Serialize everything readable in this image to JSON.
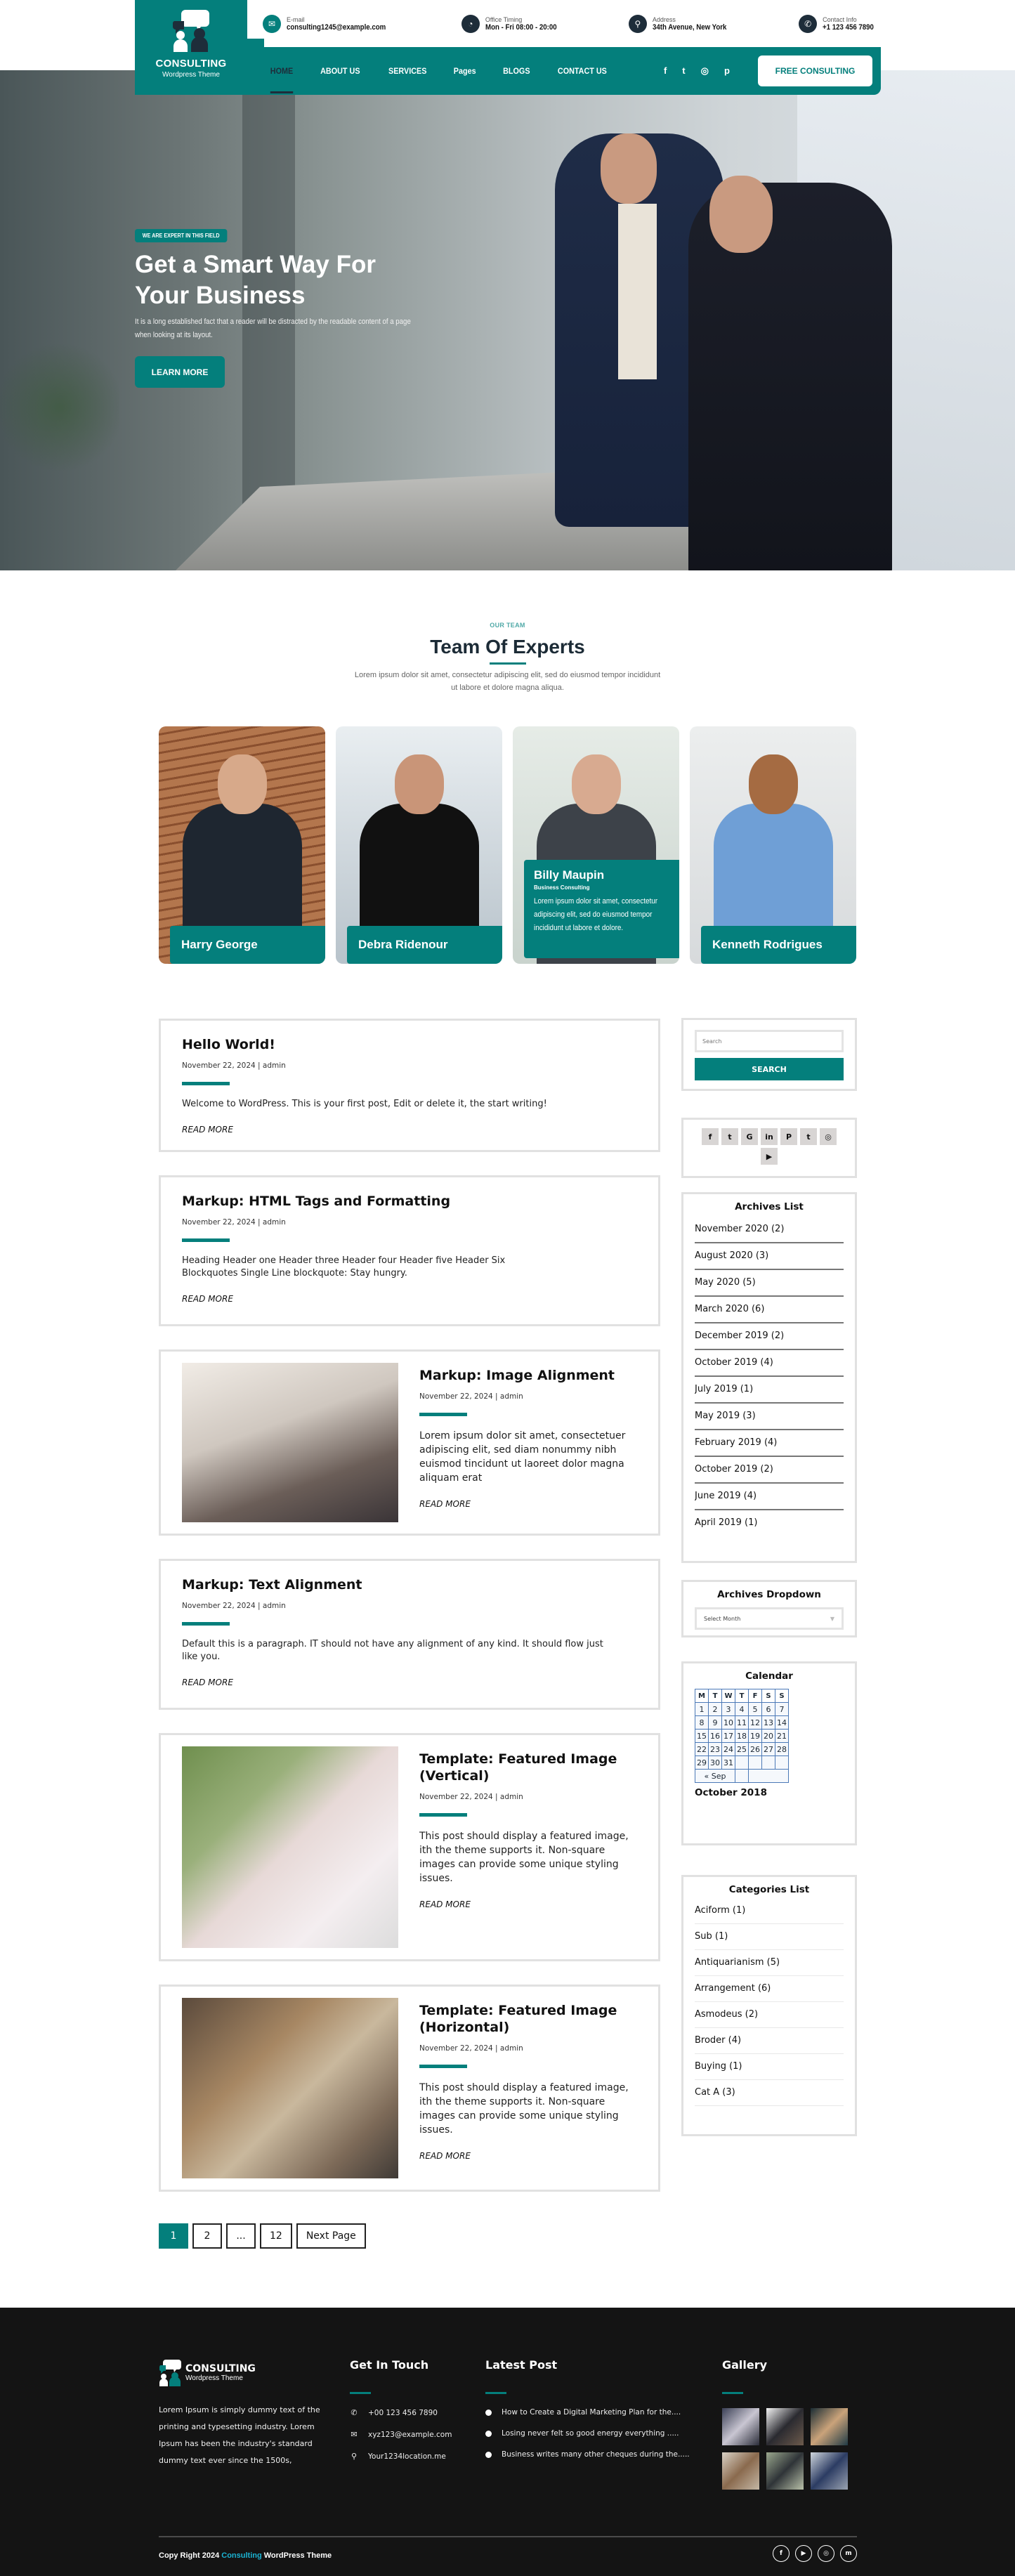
{
  "brand": {
    "title": "CONSULTING",
    "subtitle": "Wordpress Theme",
    "accent": "#047f7c",
    "dark": "#1e2d3a"
  },
  "topbar": {
    "items": [
      {
        "icon": "email-icon",
        "label": "E-mail",
        "value": "consulting1245@example.com"
      },
      {
        "icon": "clock-icon",
        "label": "Office Timing",
        "value": "Mon - Fri 08:00 - 20:00"
      },
      {
        "icon": "location-icon",
        "label": "Address",
        "value": "34th Avenue, New York"
      },
      {
        "icon": "phone-icon",
        "label": "Contact Info",
        "value": "+1 123 456 7890"
      }
    ]
  },
  "nav": {
    "links": [
      "HOME",
      "ABOUT US",
      "SERVICES",
      "Pages",
      "BLOGS",
      "CONTACT US"
    ],
    "active": "HOME",
    "social": [
      {
        "icon": "facebook-icon",
        "glyph": "f"
      },
      {
        "icon": "twitter-icon",
        "glyph": "🐦"
      },
      {
        "icon": "instagram-icon",
        "glyph": "◎"
      },
      {
        "icon": "pinterest-icon",
        "glyph": "𝓅"
      }
    ],
    "cta": "FREE CONSULTING"
  },
  "hero": {
    "badge": "WE ARE EXPERT IN THIS FIELD",
    "title": "Get a Smart Way For Your Business",
    "text": "It is a long established fact that a reader will be distracted by the readable content of a page when looking at its layout.",
    "button": "LEARN MORE"
  },
  "team": {
    "eyebrow": "OUR TEAM",
    "title": "Team Of Experts",
    "description": "Lorem ipsum dolor sit amet, consectetur adipiscing elit, sed do eiusmod tempor incididunt ut labore et dolore magna aliqua.",
    "members": [
      {
        "name": "Harry George"
      },
      {
        "name": "Debra Ridenour"
      },
      {
        "name": "Billy Maupin",
        "role": "Business Consulting",
        "bio": "Lorem ipsum dolor sit amet, consectetur adipiscing elit, sed do eiusmod tempor incididunt ut labore et dolore."
      },
      {
        "name": "Kenneth Rodrigues"
      }
    ]
  },
  "posts": [
    {
      "title": "Hello World!",
      "meta": "November 22, 2024 | admin",
      "excerpt": "Welcome to WordPress. This is your first post, Edit or delete it, the start writing!",
      "more": "READ MORE"
    },
    {
      "title": "Markup: HTML Tags and Formatting",
      "meta": "November 22, 2024 | admin",
      "excerpt": "Heading Header one Header three Header four Header five Header Six Blockquotes Single Line blockquote: Stay hungry.",
      "more": "READ MORE"
    },
    {
      "title": "Markup: Image Alignment",
      "meta": "November 22, 2024 | admin",
      "excerpt": "Lorem ipsum dolor sit amet, consectetuer adipiscing elit, sed diam nonummy nibh euismod tincidunt ut laoreet dolor magna aliquam erat",
      "more": "READ MORE"
    },
    {
      "title": "Markup: Text Alignment",
      "meta": "November 22, 2024 | admin",
      "excerpt": "Default this is a paragraph. IT should not have any alignment of any kind. It should flow just like you.",
      "more": "READ MORE"
    },
    {
      "title": "Template: Featured Image (Vertical)",
      "meta": "November 22, 2024 | admin",
      "excerpt": "This post should display a featured image, ith the theme supports it. Non-square images can provide some unique styling issues.",
      "more": "READ MORE"
    },
    {
      "title": "Template: Featured Image (Horizontal)",
      "meta": "November 22, 2024 | admin",
      "excerpt": "This post should display a featured image, ith the theme supports it. Non-square images can provide some unique styling issues.",
      "more": "READ MORE"
    }
  ],
  "pagination": {
    "pages": [
      "1",
      "2",
      "...",
      "12"
    ],
    "current": "1",
    "next": "Next Page"
  },
  "sidebar": {
    "search": {
      "placeholder": "Search",
      "button": "SEARCH"
    },
    "social": [
      {
        "icon": "facebook-icon",
        "glyph": "f"
      },
      {
        "icon": "twitter-icon",
        "glyph": "🐦"
      },
      {
        "icon": "google-icon",
        "glyph": "G"
      },
      {
        "icon": "linkedin-icon",
        "glyph": "in"
      },
      {
        "icon": "pinterest-icon",
        "glyph": "P"
      },
      {
        "icon": "tumblr-icon",
        "glyph": "t"
      },
      {
        "icon": "instagram-icon",
        "glyph": "◎"
      },
      {
        "icon": "youtube-icon",
        "glyph": "▶"
      }
    ],
    "archives_title": "Archives List",
    "archives": [
      "November 2020 (2)",
      "August 2020 (3)",
      "May 2020 (5)",
      "March 2020 (6)",
      "December 2019 (2)",
      "October 2019 (4)",
      "July 2019 (1)",
      "May 2019 (3)",
      "February 2019 (4)",
      "October 2019 (2)",
      "June 2019 (4)",
      "April 2019 (1)"
    ],
    "dropdown_title": "Archives Dropdown",
    "dropdown_value": "Select Month",
    "calendar_title": "Calendar",
    "calendar": {
      "headers": [
        "M",
        "T",
        "W",
        "T",
        "F",
        "S",
        "S"
      ],
      "weeks": [
        [
          "1",
          "2",
          "3",
          "4",
          "5",
          "6",
          "7"
        ],
        [
          "8",
          "9",
          "10",
          "11",
          "12",
          "13",
          "14"
        ],
        [
          "15",
          "16",
          "17",
          "18",
          "19",
          "20",
          "21"
        ],
        [
          "22",
          "23",
          "24",
          "25",
          "26",
          "27",
          "28"
        ],
        [
          "29",
          "30",
          "31",
          "",
          "",
          "",
          ""
        ]
      ],
      "prev": "« Sep",
      "caption": "October 2018"
    },
    "categories_title": "Categories List",
    "categories": [
      "Aciform (1)",
      "Sub (1)",
      "Antiquarianism (5)",
      "Arrangement (6)",
      "Asmodeus (2)",
      "Broder (4)",
      "Buying (1)",
      "Cat A (3)"
    ]
  },
  "footer": {
    "about": "Lorem Ipsum is simply dummy text of the printing and typesetting industry. Lorem Ipsum has been the industry's standard dummy text ever since the 1500s,",
    "contact_title": "Get In Touch",
    "contacts": [
      {
        "icon": "phone-icon",
        "glyph": "✆",
        "text": "+00 123 456 7890"
      },
      {
        "icon": "mail-icon",
        "glyph": "✉",
        "text": "xyz123@example.com"
      },
      {
        "icon": "location-icon",
        "glyph": "⚲",
        "text": "Your1234location.me"
      }
    ],
    "latest_title": "Latest Post",
    "latest": [
      "How to Create a Digital Marketing Plan for the....",
      "Losing never felt so good energy everything .....",
      "Business writes many other cheques during the....."
    ],
    "gallery_title": "Gallery",
    "copyright_prefix": "Copy Right  2024 ",
    "copyright_brand": "Consulting",
    "copyright_suffix": " WordPress Theme",
    "social": [
      {
        "icon": "facebook-icon",
        "glyph": "f"
      },
      {
        "icon": "youtube-icon",
        "glyph": "▶"
      },
      {
        "icon": "instagram-icon",
        "glyph": "◎"
      },
      {
        "icon": "medium-icon",
        "glyph": "m"
      }
    ]
  }
}
